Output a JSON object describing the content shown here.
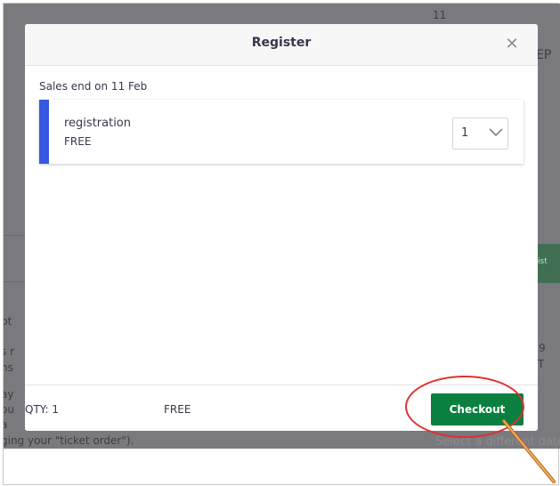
{
  "background": {
    "fragments": [
      "11",
      "EP",
      "pt",
      "s r",
      "ns",
      "ay",
      "ou",
      "a",
      "9",
      "T",
      "ging your \"ticket order\")."
    ],
    "green_button_label": "ist",
    "below_modal_text": "Select a different date"
  },
  "modal": {
    "title": "Register",
    "close_icon": "close-icon",
    "sales_end_text": "Sales end on 11 Feb",
    "ticket": {
      "name": "registration",
      "price": "FREE",
      "quantity": "1",
      "accent_color": "#3659e3"
    },
    "footer": {
      "qty_text": "QTY: 1",
      "total_text": "FREE",
      "checkout_label": "Checkout",
      "checkout_color": "#0a7f3f"
    }
  },
  "annotation": {
    "ellipse_color": "#e03030",
    "arrow_color": "#e8a040"
  }
}
